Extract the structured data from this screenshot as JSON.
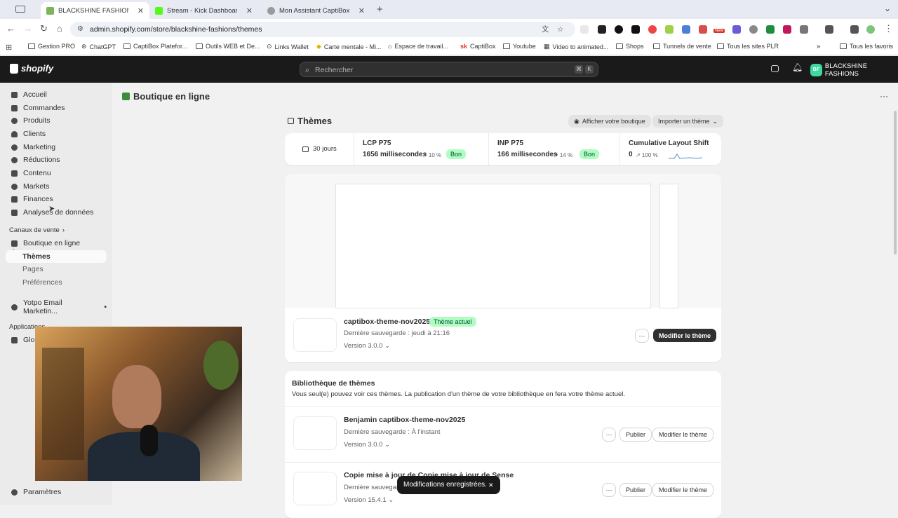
{
  "browser": {
    "tabs": [
      {
        "title": "BLACKSHINE FASHIONS – Mo",
        "fav_color": "#7ab55c",
        "active": true
      },
      {
        "title": "Stream - Kick Dashboard",
        "fav_color": "#53fc18",
        "active": false
      },
      {
        "title": "Mon Assistant CaptiBox - MA",
        "fav_color": "#9a9a9a",
        "active": false
      }
    ],
    "url": "admin.shopify.com/store/blackshine-fashions/themes",
    "bookmarks": [
      "Gestion PRO",
      "ChatGPT",
      "CaptiBox Platefor...",
      "Outils WEB et De...",
      "Links Wallet",
      "Carte mentale - Mi...",
      "Espace de travail...",
      "CaptiBox",
      "Youtube",
      "Video to animated...",
      "Shops",
      "Tunnels de vente",
      "Tous les sites PLR"
    ],
    "all_bookmarks": "Tous les favoris",
    "ext_badge": "New"
  },
  "shopify": {
    "logo_text": "shopify",
    "search_placeholder": "Rechercher",
    "kbd1": "⌘",
    "kbd2": "K",
    "store_initials": "BF",
    "store_name": "BLACKSHINE FASHIONS"
  },
  "sidebar": {
    "items": [
      "Accueil",
      "Commandes",
      "Produits",
      "Clients",
      "Marketing",
      "Réductions",
      "Contenu",
      "Markets",
      "Finances",
      "Analyses de données"
    ],
    "sales_channels_label": "Canaux de vente",
    "online_store": "Boutique en ligne",
    "sub_items": [
      "Thèmes",
      "Pages",
      "Préférences"
    ],
    "yotpo": "Yotpo Email Marketin...",
    "applications_label": "Applications",
    "glob": "Glob",
    "settings": "Paramètres"
  },
  "page": {
    "header": "Boutique en ligne",
    "section_title": "Thèmes",
    "view_store": "Afficher votre boutique",
    "import_theme": "Importer un thème"
  },
  "metrics": {
    "period": "30 jours",
    "lcp_label": "LCP P75",
    "lcp_value": "1656 millisecondes",
    "lcp_change": "↗ 10 %",
    "lcp_status": "Bon",
    "inp_label": "INP P75",
    "inp_value": "166 millisecondes",
    "inp_change": "↗ 14 %",
    "inp_status": "Bon",
    "cls_label": "Cumulative Layout Shift",
    "cls_value": "0",
    "cls_change": "↗ 100 %"
  },
  "current_theme": {
    "name": "captibox-theme-nov2025",
    "badge": "Thème actuel",
    "saved": "Dernière sauvegarde : jeudi à 21:16",
    "version": "Version 3.0.0",
    "edit": "Modifier le thème"
  },
  "library": {
    "title": "Bibliothèque de thèmes",
    "description": "Vous seul(e) pouvez voir ces thèmes. La publication d'un thème de votre bibliothèque en fera votre thème actuel.",
    "themes": [
      {
        "name": "Benjamin captibox-theme-nov2025",
        "saved": "Dernière sauvegarde : À l'instant",
        "version": "Version 3.0.0"
      },
      {
        "name": "Copie mise à jour de Copie mise à jour de Sense",
        "saved": "Dernière sauvegarde : ...",
        "version": "Version 15.4.1"
      }
    ],
    "publish": "Publier",
    "edit": "Modifier le thème"
  },
  "toast": {
    "message": "Modifications enregistrées.",
    "close": "✕"
  }
}
